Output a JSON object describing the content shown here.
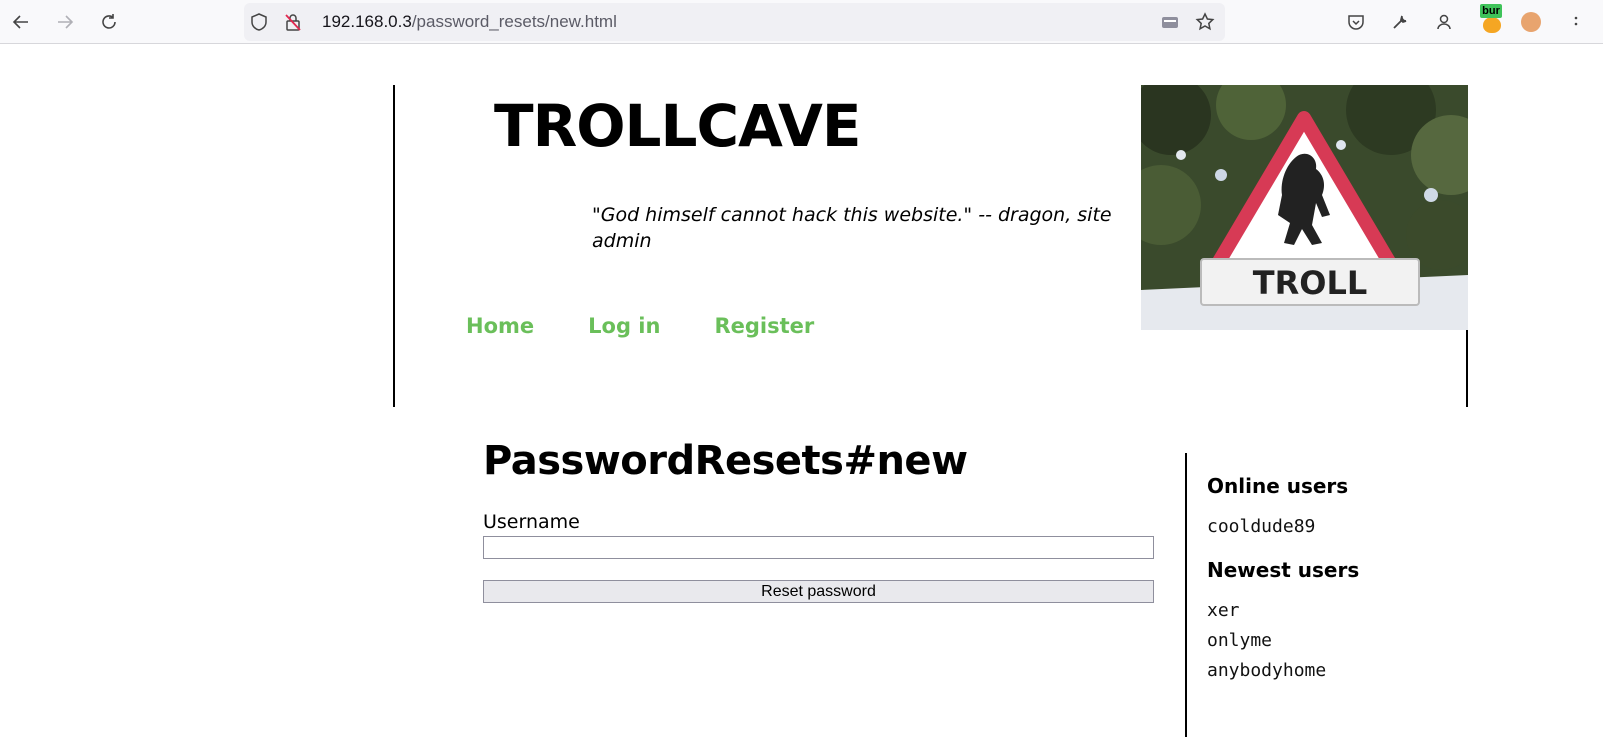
{
  "browser": {
    "url_host": "192.168.0.3",
    "url_path": "/password_resets/new.html",
    "extension_badge": "bur"
  },
  "site": {
    "title": "TROLLCAVE",
    "tagline": "\"God himself cannot hack this website.\" -- dragon, site admin",
    "sign_text": "TROLL",
    "nav": [
      {
        "label": "Home"
      },
      {
        "label": "Log in"
      },
      {
        "label": "Register"
      }
    ],
    "link_color": "#6abf5a"
  },
  "main": {
    "heading": "PasswordResets#new",
    "username_label": "Username",
    "username_value": "",
    "submit_label": "Reset password"
  },
  "sidebar": {
    "online_heading": "Online users",
    "online_users": [
      "cooldude89"
    ],
    "newest_heading": "Newest users",
    "newest_users": [
      "xer",
      "onlyme",
      "anybodyhome"
    ]
  }
}
